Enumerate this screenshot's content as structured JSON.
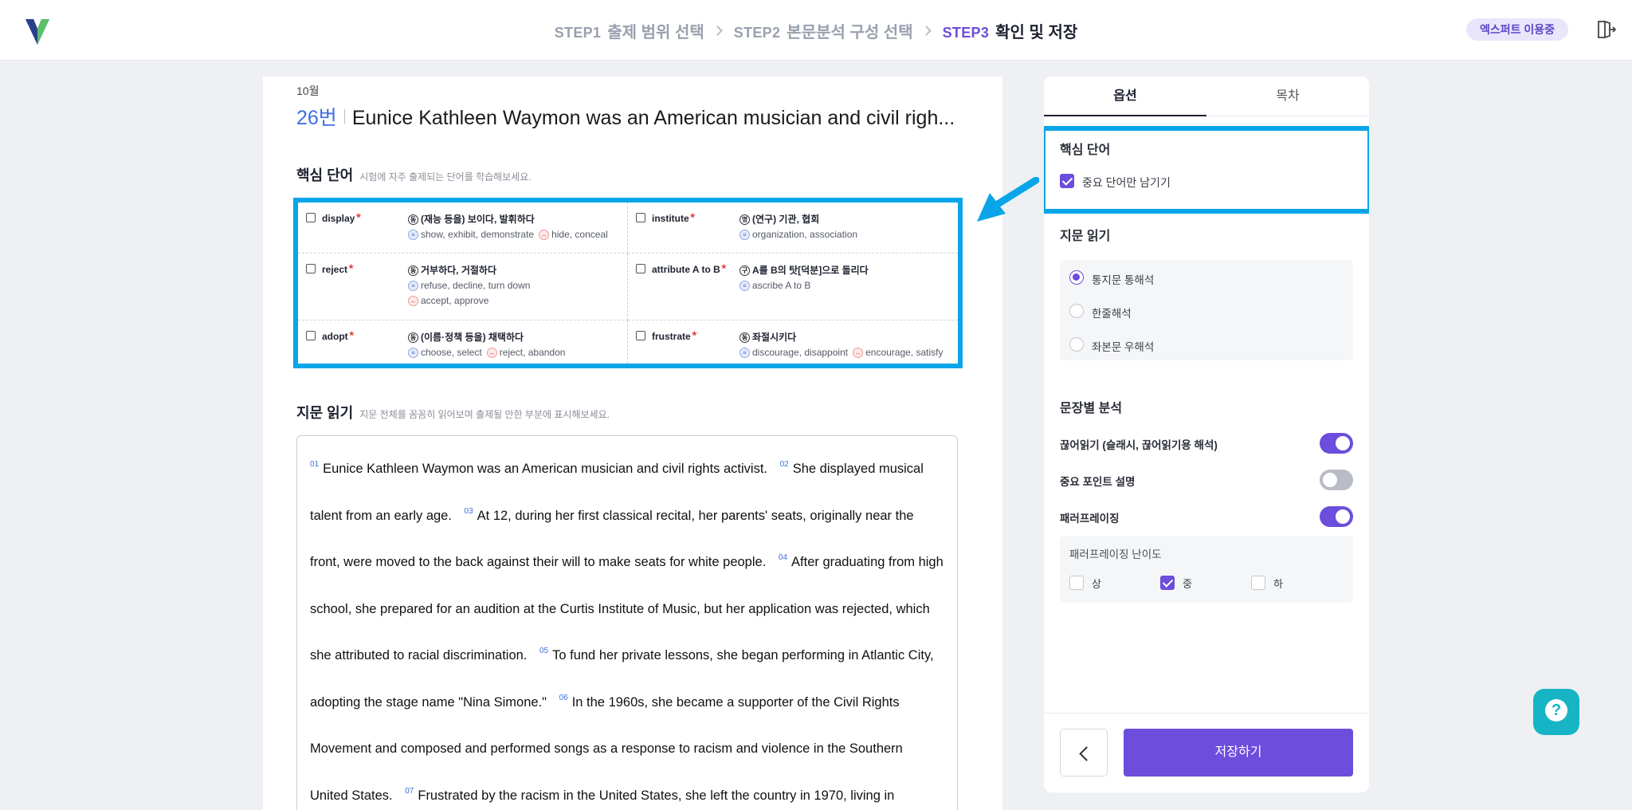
{
  "header": {
    "steps": [
      {
        "num": "STEP1",
        "label": "출제 범위 선택",
        "active": false
      },
      {
        "num": "STEP2",
        "label": "본문분석 구성 선택",
        "active": false
      },
      {
        "num": "STEP3",
        "label": "확인 및 저장",
        "active": true
      }
    ],
    "badge": "엑스퍼트 이용중",
    "logo_icon": "logo-icon",
    "logout_icon": "logout-icon",
    "colors": {
      "accent": "#6c4ddc",
      "highlight": "#0aa5e8"
    }
  },
  "main": {
    "month": "10월",
    "question_number": "26번",
    "question_title": "Eunice Kathleen Waymon was an American musician and civil righ...",
    "vocab_section": {
      "title": "핵심 단어",
      "subtitle": "시험에 자주 출제되는 단어를 학습해보세요.",
      "items": [
        {
          "word": "display",
          "pos": "동",
          "meaning": "(재능 등을) 보이다, 발휘하다",
          "syn": "show, exhibit, demonstrate",
          "ant": "hide, conceal"
        },
        {
          "word": "institute",
          "pos": "명",
          "meaning": "(연구) 기관, 협회",
          "syn": "organization, association",
          "ant": ""
        },
        {
          "word": "reject",
          "pos": "동",
          "meaning": "거부하다, 거절하다",
          "syn": "refuse, decline, turn down",
          "ant": "accept, approve"
        },
        {
          "word": "attribute A to B",
          "pos": "구",
          "meaning": "A를 B의 탓[덕분]으로 돌리다",
          "syn": "ascribe A to B",
          "ant": ""
        },
        {
          "word": "adopt",
          "pos": "동",
          "meaning": "(이름·정책 등을) 채택하다",
          "syn": "choose, select",
          "ant": "reject, abandon"
        },
        {
          "word": "frustrate",
          "pos": "동",
          "meaning": "좌절시키다",
          "syn": "discourage, disappoint",
          "ant": "encourage, satisfy"
        }
      ],
      "syn_symbol": "≡",
      "ant_symbol": "↔"
    },
    "reading_section": {
      "title": "지문 읽기",
      "subtitle": "지문 전체를 꼼꼼히 읽어보며 출제될 만한 부분에 표시해보세요.",
      "sentences": [
        {
          "n": "01",
          "text": "Eunice Kathleen Waymon was an American musician and civil rights activist."
        },
        {
          "n": "02",
          "text": "She displayed musical talent from an early age."
        },
        {
          "n": "03",
          "text": "At 12, during her first classical recital, her parents' seats, originally near the front, were moved to the back against their will to make seats for white people."
        },
        {
          "n": "04",
          "text": "After graduating from high school, she prepared for an audition at the Curtis Institute of Music, but her application was rejected, which she attributed to racial discrimination."
        },
        {
          "n": "05",
          "text": "To fund her private lessons, she began performing in Atlantic City, adopting the stage name \"Nina Simone.\""
        },
        {
          "n": "06",
          "text": "In the 1960s, she became a supporter of the Civil Rights Movement and composed and performed songs as a response to racism and violence in the Southern United States."
        },
        {
          "n": "07",
          "text": "Frustrated by the racism in the United States, she left the country in 1970, living in various"
        }
      ]
    }
  },
  "side": {
    "tabs": [
      {
        "label": "옵션",
        "active": true
      },
      {
        "label": "목차",
        "active": false
      }
    ],
    "vocab": {
      "title": "핵심 단어",
      "checkbox_label": "중요 단어만 남기기",
      "checked": true
    },
    "reading": {
      "title": "지문 읽기",
      "options": [
        {
          "label": "통지문 통해석",
          "selected": true
        },
        {
          "label": "한줄해석",
          "selected": false
        },
        {
          "label": "좌본문 우해석",
          "selected": false
        }
      ]
    },
    "sentence_analysis": {
      "title": "문장별 분석",
      "toggles": [
        {
          "label": "끊어읽기 (슬래시, 끊어읽기용 해석)",
          "on": true
        },
        {
          "label": "중요 포인트 설명",
          "on": false
        },
        {
          "label": "패러프레이징",
          "on": true
        }
      ],
      "difficulty": {
        "title": "패러프레이징 난이도",
        "options": [
          {
            "label": "상",
            "checked": false
          },
          {
            "label": "중",
            "checked": true
          },
          {
            "label": "하",
            "checked": false
          }
        ]
      }
    },
    "save_label": "저장하기",
    "help_icon": "?"
  }
}
